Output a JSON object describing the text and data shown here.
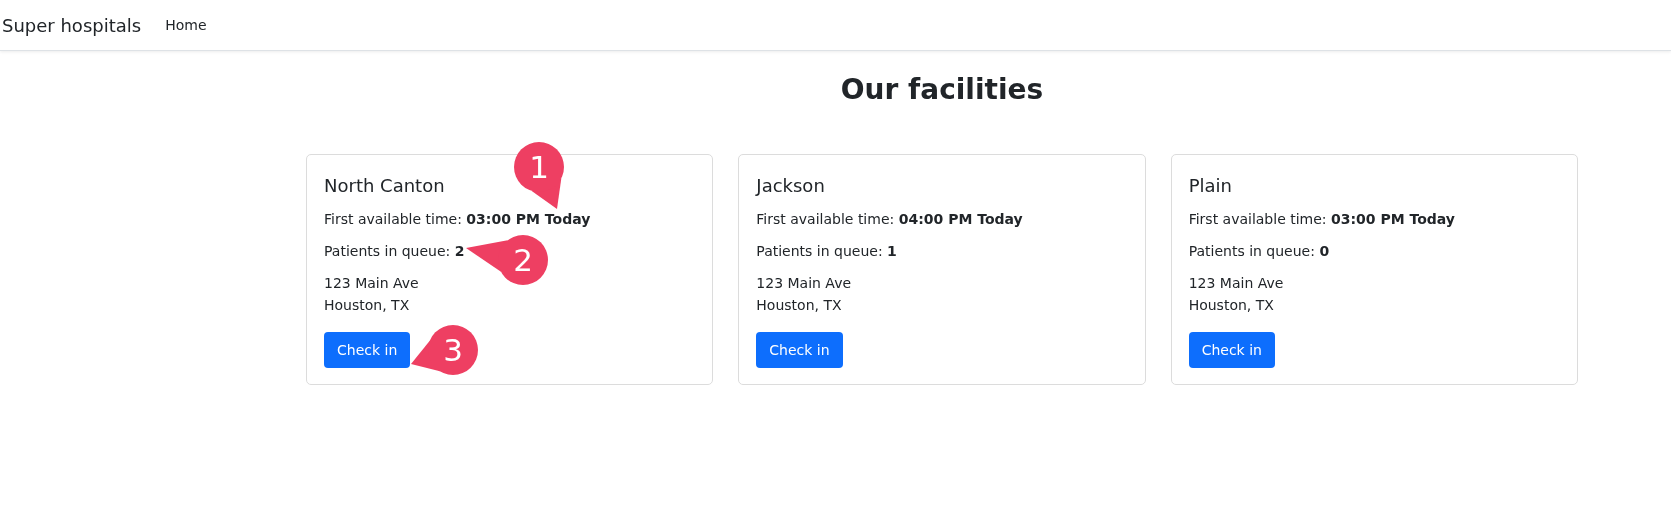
{
  "navbar": {
    "brand": "Super hospitals",
    "links": [
      {
        "label": "Home"
      }
    ]
  },
  "title": "Our facilities",
  "facilities": [
    {
      "name": "North Canton",
      "time_label": "First available time:",
      "time": "03:00 PM Today",
      "queue_label": "Patients in queue:",
      "queue": "2",
      "address": [
        "123 Main Ave",
        "Houston, TX"
      ],
      "button": "Check in"
    },
    {
      "name": "Jackson",
      "time_label": "First available time:",
      "time": "04:00 PM Today",
      "queue_label": "Patients in queue:",
      "queue": "1",
      "address": [
        "123 Main Ave",
        "Houston, TX"
      ],
      "button": "Check in"
    },
    {
      "name": "Plain",
      "time_label": "First available time:",
      "time": "03:00 PM Today",
      "queue_label": "Patients in queue:",
      "queue": "0",
      "address": [
        "123 Main Ave",
        "Houston, TX"
      ],
      "button": "Check in"
    }
  ],
  "callouts": [
    {
      "label": "1"
    },
    {
      "label": "2"
    },
    {
      "label": "3"
    }
  ]
}
